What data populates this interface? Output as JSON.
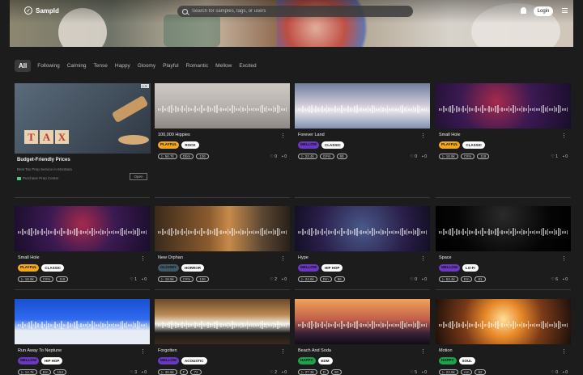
{
  "app": {
    "name": "Sampld"
  },
  "search": {
    "placeholder": "Search for samples, tags, or users"
  },
  "header": {
    "login_label": "Login"
  },
  "filters": [
    "All",
    "Following",
    "Calming",
    "Tense",
    "Happy",
    "Gloomy",
    "Playful",
    "Romantic",
    "Mellow",
    "Excited"
  ],
  "ad": {
    "title": "Budget-Friendly Prices",
    "subtitle": "Best Tax Prep Service in Montana",
    "source": "Purchase Prep Center",
    "open_label": "Open",
    "tiles": [
      "T",
      "A",
      "X"
    ]
  },
  "colors": {
    "playful": "#f2a81d",
    "mellow": "#6a38c2",
    "gloomy": "#3f5a66",
    "happy": "#1fa34a"
  },
  "cards": [
    {
      "title": "100,000 Hippies",
      "mood": "PLAYFUL",
      "mood_color": "#f2a81d",
      "genre": "ROCK",
      "plays": "56.7k",
      "key": "Dbm",
      "bpm": "126",
      "likes": "0",
      "comments": "0"
    },
    {
      "title": "Forever Land",
      "mood": "MELLOW",
      "mood_color": "#6a38c2",
      "genre": "CLASSIC",
      "plays": "23.4k",
      "key": "G#m",
      "bpm": "99",
      "likes": "0",
      "comments": "0"
    },
    {
      "title": "Small Hole",
      "mood": "PLAYFUL",
      "mood_color": "#f2a81d",
      "genre": "CLASSIC",
      "plays": "18.9k",
      "key": "C#m",
      "bpm": "118",
      "likes": "1",
      "comments": "0"
    },
    {
      "title": "Small Hole",
      "mood": "PLAYFUL",
      "mood_color": "#f2a81d",
      "genre": "CLASSIC",
      "plays": "18.9k",
      "key": "C#m",
      "bpm": "118",
      "likes": "1",
      "comments": "0"
    },
    {
      "title": "New Orphan",
      "mood": "GLOOMY",
      "mood_color": "#3f5a66",
      "genre": "HORROR",
      "plays": "18.5k",
      "key": "C#m",
      "bpm": "136",
      "likes": "2",
      "comments": "0"
    },
    {
      "title": "Hype",
      "mood": "MELLOW",
      "mood_color": "#6a38c2",
      "genre": "HIP HOP",
      "plays": "24.6k",
      "key": "Dm",
      "bpm": "86",
      "likes": "0",
      "comments": "0"
    },
    {
      "title": "Space",
      "mood": "MELLOW",
      "mood_color": "#6a38c2",
      "genre": "LO-FI",
      "plays": "53.4k",
      "key": "Em",
      "bpm": "81",
      "likes": "6",
      "comments": "0"
    },
    {
      "title": "Run Away To Neptune",
      "mood": "MELLOW",
      "mood_color": "#6a38c2",
      "genre": "HIP HOP",
      "plays": "14.7k",
      "key": "Bm",
      "bpm": "154",
      "likes": "3",
      "comments": "0"
    },
    {
      "title": "Forgotten",
      "mood": "MELLOW",
      "mood_color": "#6a38c2",
      "genre": "ACOUSTIC",
      "plays": "38.6k",
      "key": "F",
      "bpm": "72",
      "likes": "2",
      "comments": "0"
    },
    {
      "title": "Beach And Soda",
      "mood": "HAPPY",
      "mood_color": "#1fa34a",
      "genre": "EDM",
      "plays": "27.3k",
      "key": "D",
      "bpm": "90",
      "likes": "5",
      "comments": "0"
    },
    {
      "title": "Motion",
      "mood": "HAPPY",
      "mood_color": "#1fa34a",
      "genre": "SOUL",
      "plays": "23.5k",
      "key": "Am",
      "bpm": "92",
      "likes": "0",
      "comments": "0"
    }
  ],
  "thumbs": [
    "linear-gradient(180deg,#cfc9c4 0%,#b7b2ad 50%,#8d8885 100%)",
    "linear-gradient(180deg,#6f7f9c 0%,#c9c5d6 45%,#eae5ea 60%,#7f8fae 100%)",
    "radial-gradient(circle at 45% 40%,#a52a4d 0%,#3b1a52 45%,#1a0d2c 100%)",
    "radial-gradient(circle at 50% 40%,#a52a4d 0%,#3b1a52 45%,#1a0d2c 100%)",
    "linear-gradient(90deg,#3a2a1c 0%,#8a5b2e 40%,#c78a4a 55%,#5a4633 80%,#2a2018 100%)",
    "radial-gradient(circle at 50% 50%,#4a5a8a 0%,#2a1f4a 60%,#120f24 100%)",
    "radial-gradient(circle at 50% 20%,#2a2a2a 0%,#050505 60%,#000 100%)",
    "linear-gradient(180deg,#1a4fd1 0%,#2f6bf0 45%,#e8edf5 70%,#e8edf5 100%)",
    "linear-gradient(180deg,#6d4a2a 0%,#b98a55 35%,#f2efe6 55%,#1b1b1b 75%,#3a2a1c 100%)",
    "linear-gradient(180deg,#f2a15a 0%,#c0604a 45%,#3a2238 75%,#120c18 100%)",
    "radial-gradient(circle at 50% 45%,#ffdf9a 0%,#e88a2a 25%,#7a3a18 55%,#1a0f0a 100%)"
  ]
}
